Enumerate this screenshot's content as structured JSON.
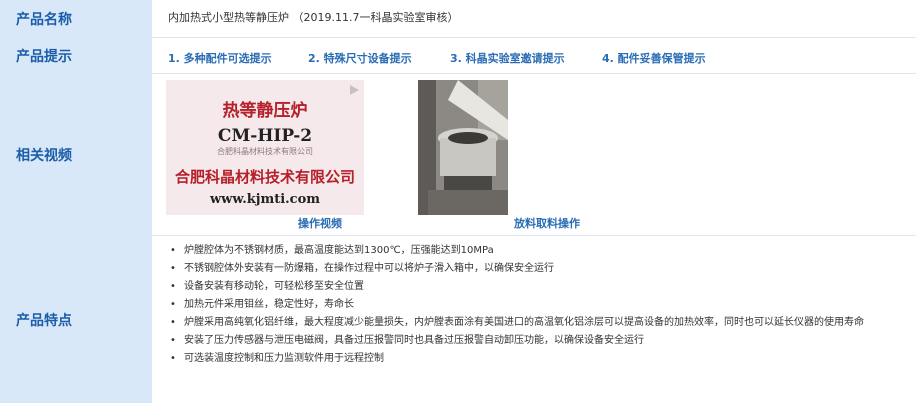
{
  "rows": {
    "name": {
      "label": "产品名称",
      "value": "内加热式小型热等静压炉 （2019.11.7一科晶实验室审核）"
    },
    "tips": {
      "label": "产品提示",
      "items": [
        "1. 多种配件可选提示",
        "2. 特殊尺寸设备提示",
        "3. 科晶实验室邀请提示",
        "4. 配件妥善保管提示"
      ]
    },
    "videos": {
      "label": "相关视频",
      "video1": {
        "line1": "热等静压炉",
        "line2": "CM-HIP-2",
        "line3": "合肥科晶材料技术有限公司",
        "line4": "合肥科晶材料技术有限公司",
        "line5": "www.kjmti.com",
        "caption": "操作视频"
      },
      "video2": {
        "caption": "放料取料操作"
      }
    },
    "features": {
      "label": "产品特点",
      "items": [
        "炉膛腔体为不锈钢材质，最高温度能达到1300℃，压强能达到10MPa",
        "不锈钢腔体外安装有一防爆箱，在操作过程中可以将炉子滑入箱中，以确保安全运行",
        "设备安装有移动轮，可轻松移至安全位置",
        "加热元件采用钼丝，稳定性好，寿命长",
        "炉膛采用高纯氧化铝纤维，最大程度减少能量损失，内炉膛表面涂有美国进口的高温氧化铝涂层可以提高设备的加热效率，同时也可以延长仪器的使用寿命",
        "安装了压力传感器与泄压电磁阀，具备过压报警同时也具备过压报警自动卸压功能，以确保设备安全运行",
        "可选装温度控制和压力监测软件用于远程控制"
      ]
    }
  },
  "colors": {
    "label_bg": "#d9e8f8",
    "label_text": "#1a5da8",
    "link": "#2a6db5"
  }
}
